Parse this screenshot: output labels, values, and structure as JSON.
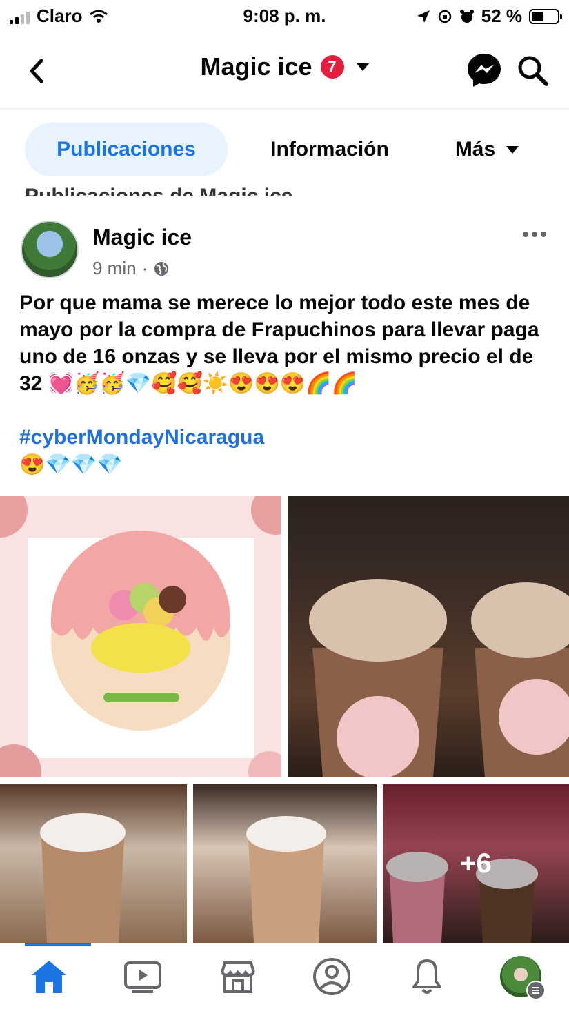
{
  "status_bar": {
    "carrier": "Claro",
    "time": "9:08 p. m.",
    "battery": "52 %",
    "battery_level": 0.52
  },
  "header": {
    "page_name": "Magic ice",
    "notification_count": "7"
  },
  "tabs": [
    {
      "label": "Publicaciones",
      "active": true
    },
    {
      "label": "Información",
      "active": false
    },
    {
      "label": "Más",
      "active": false
    }
  ],
  "section_title": "Publicaciones de Magic ice",
  "post": {
    "author": "Magic ice",
    "time": "9 min",
    "privacy_icon": "globe-icon",
    "text": "Por que mama se merece lo mejor todo este mes de mayo por la compra de Frapuchinos para llevar paga uno de 16 onzas y se lleva por el mismo precio el de 32 💓🥳🥳💎🥰🥰☀️😍😍😍🌈🌈",
    "hashtag": "#cyberMondayNicaragua",
    "emoji_line": "😍💎💎💎",
    "more_photos": "+6"
  },
  "colors": {
    "accent": "#1b74e4",
    "badge": "#e41e3f",
    "hashtag": "#216fdb"
  },
  "bottom_nav": [
    "home-icon",
    "video-icon",
    "marketplace-icon",
    "profile-icon",
    "notifications-icon",
    "menu-avatar"
  ]
}
